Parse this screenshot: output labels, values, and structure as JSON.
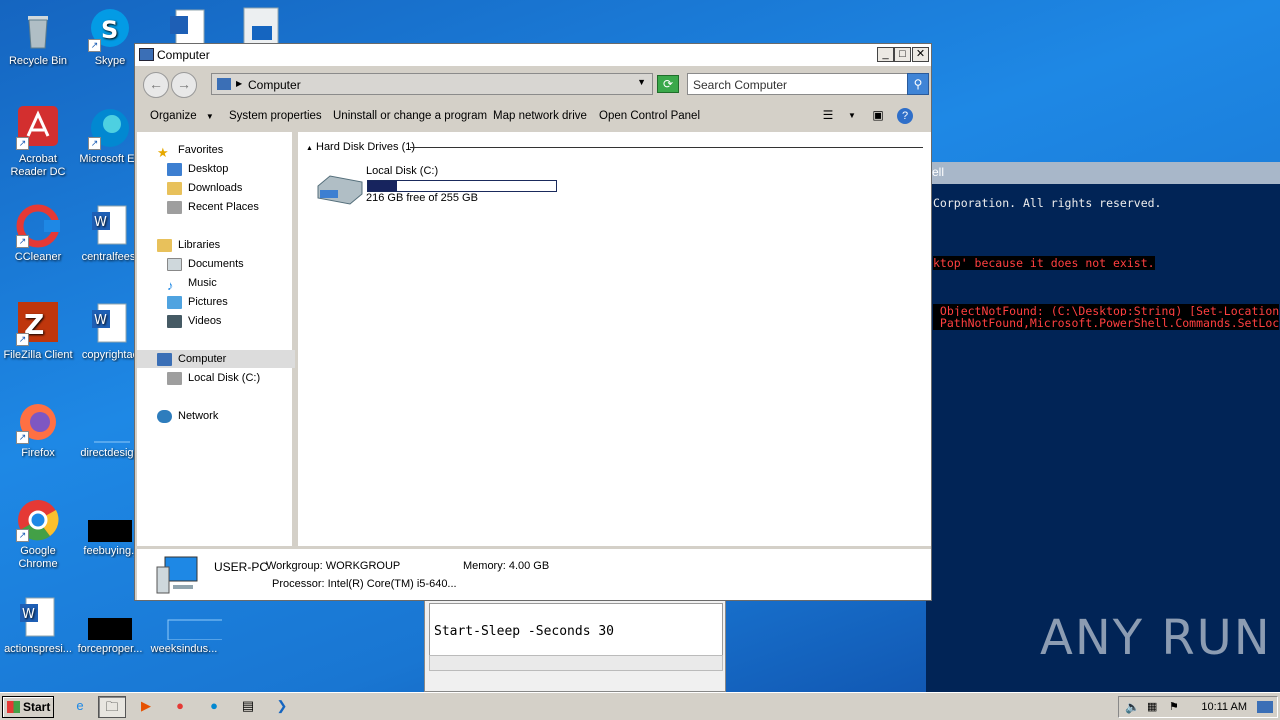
{
  "desktop": {
    "icons": [
      {
        "label": "Recycle Bin"
      },
      {
        "label": "Skype"
      },
      {
        "label": "Acrobat Reader DC"
      },
      {
        "label": "Microsoft Ed"
      },
      {
        "label": "CCleaner"
      },
      {
        "label": "centralfees."
      },
      {
        "label": "FileZilla Client"
      },
      {
        "label": "copyrightac"
      },
      {
        "label": "Firefox"
      },
      {
        "label": "directdesign"
      },
      {
        "label": "Google Chrome"
      },
      {
        "label": "feebuying.j"
      },
      {
        "label": "actionspresi..."
      },
      {
        "label": "forceproper..."
      },
      {
        "label": "weeksindus..."
      }
    ]
  },
  "powershell": {
    "title": "ell",
    "lines": [
      "Corporation. All rights reserved.",
      "ktop' because it does not exist.",
      " ObjectNotFound: (C:\\Desktop:String) [Set-Location",
      " PathNotFound,Microsoft.PowerShell.Commands.SetLoc"
    ]
  },
  "notepad": {
    "text": "Start-Sleep -Seconds 30"
  },
  "explorer": {
    "title": "Computer",
    "address": "Computer",
    "search_placeholder": "Search Computer",
    "toolbar": {
      "organize": "Organize",
      "system_properties": "System properties",
      "uninstall": "Uninstall or change a program",
      "map_drive": "Map network drive",
      "control_panel": "Open Control Panel"
    },
    "nav": {
      "favorites": "Favorites",
      "desktop": "Desktop",
      "downloads": "Downloads",
      "recent": "Recent Places",
      "libraries": "Libraries",
      "documents": "Documents",
      "music": "Music",
      "pictures": "Pictures",
      "videos": "Videos",
      "computer": "Computer",
      "local_disk": "Local Disk (C:)",
      "network": "Network"
    },
    "group_header": "Hard Disk Drives (1)",
    "drive": {
      "name": "Local Disk (C:)",
      "free_text": "216 GB free of 255 GB",
      "used_fraction": 0.153
    },
    "details": {
      "pc_name": "USER-PC",
      "workgroup": "Workgroup: WORKGROUP",
      "memory": "Memory: 4.00 GB",
      "processor": "Processor: Intel(R) Core(TM) i5-640..."
    }
  },
  "taskbar": {
    "start": "Start",
    "clock": "10:11 AM"
  },
  "watermark": "ANY RUN",
  "colors": {
    "ps_bg": "#012456",
    "error": "#ff4040",
    "drive_fill": "#17245e"
  }
}
